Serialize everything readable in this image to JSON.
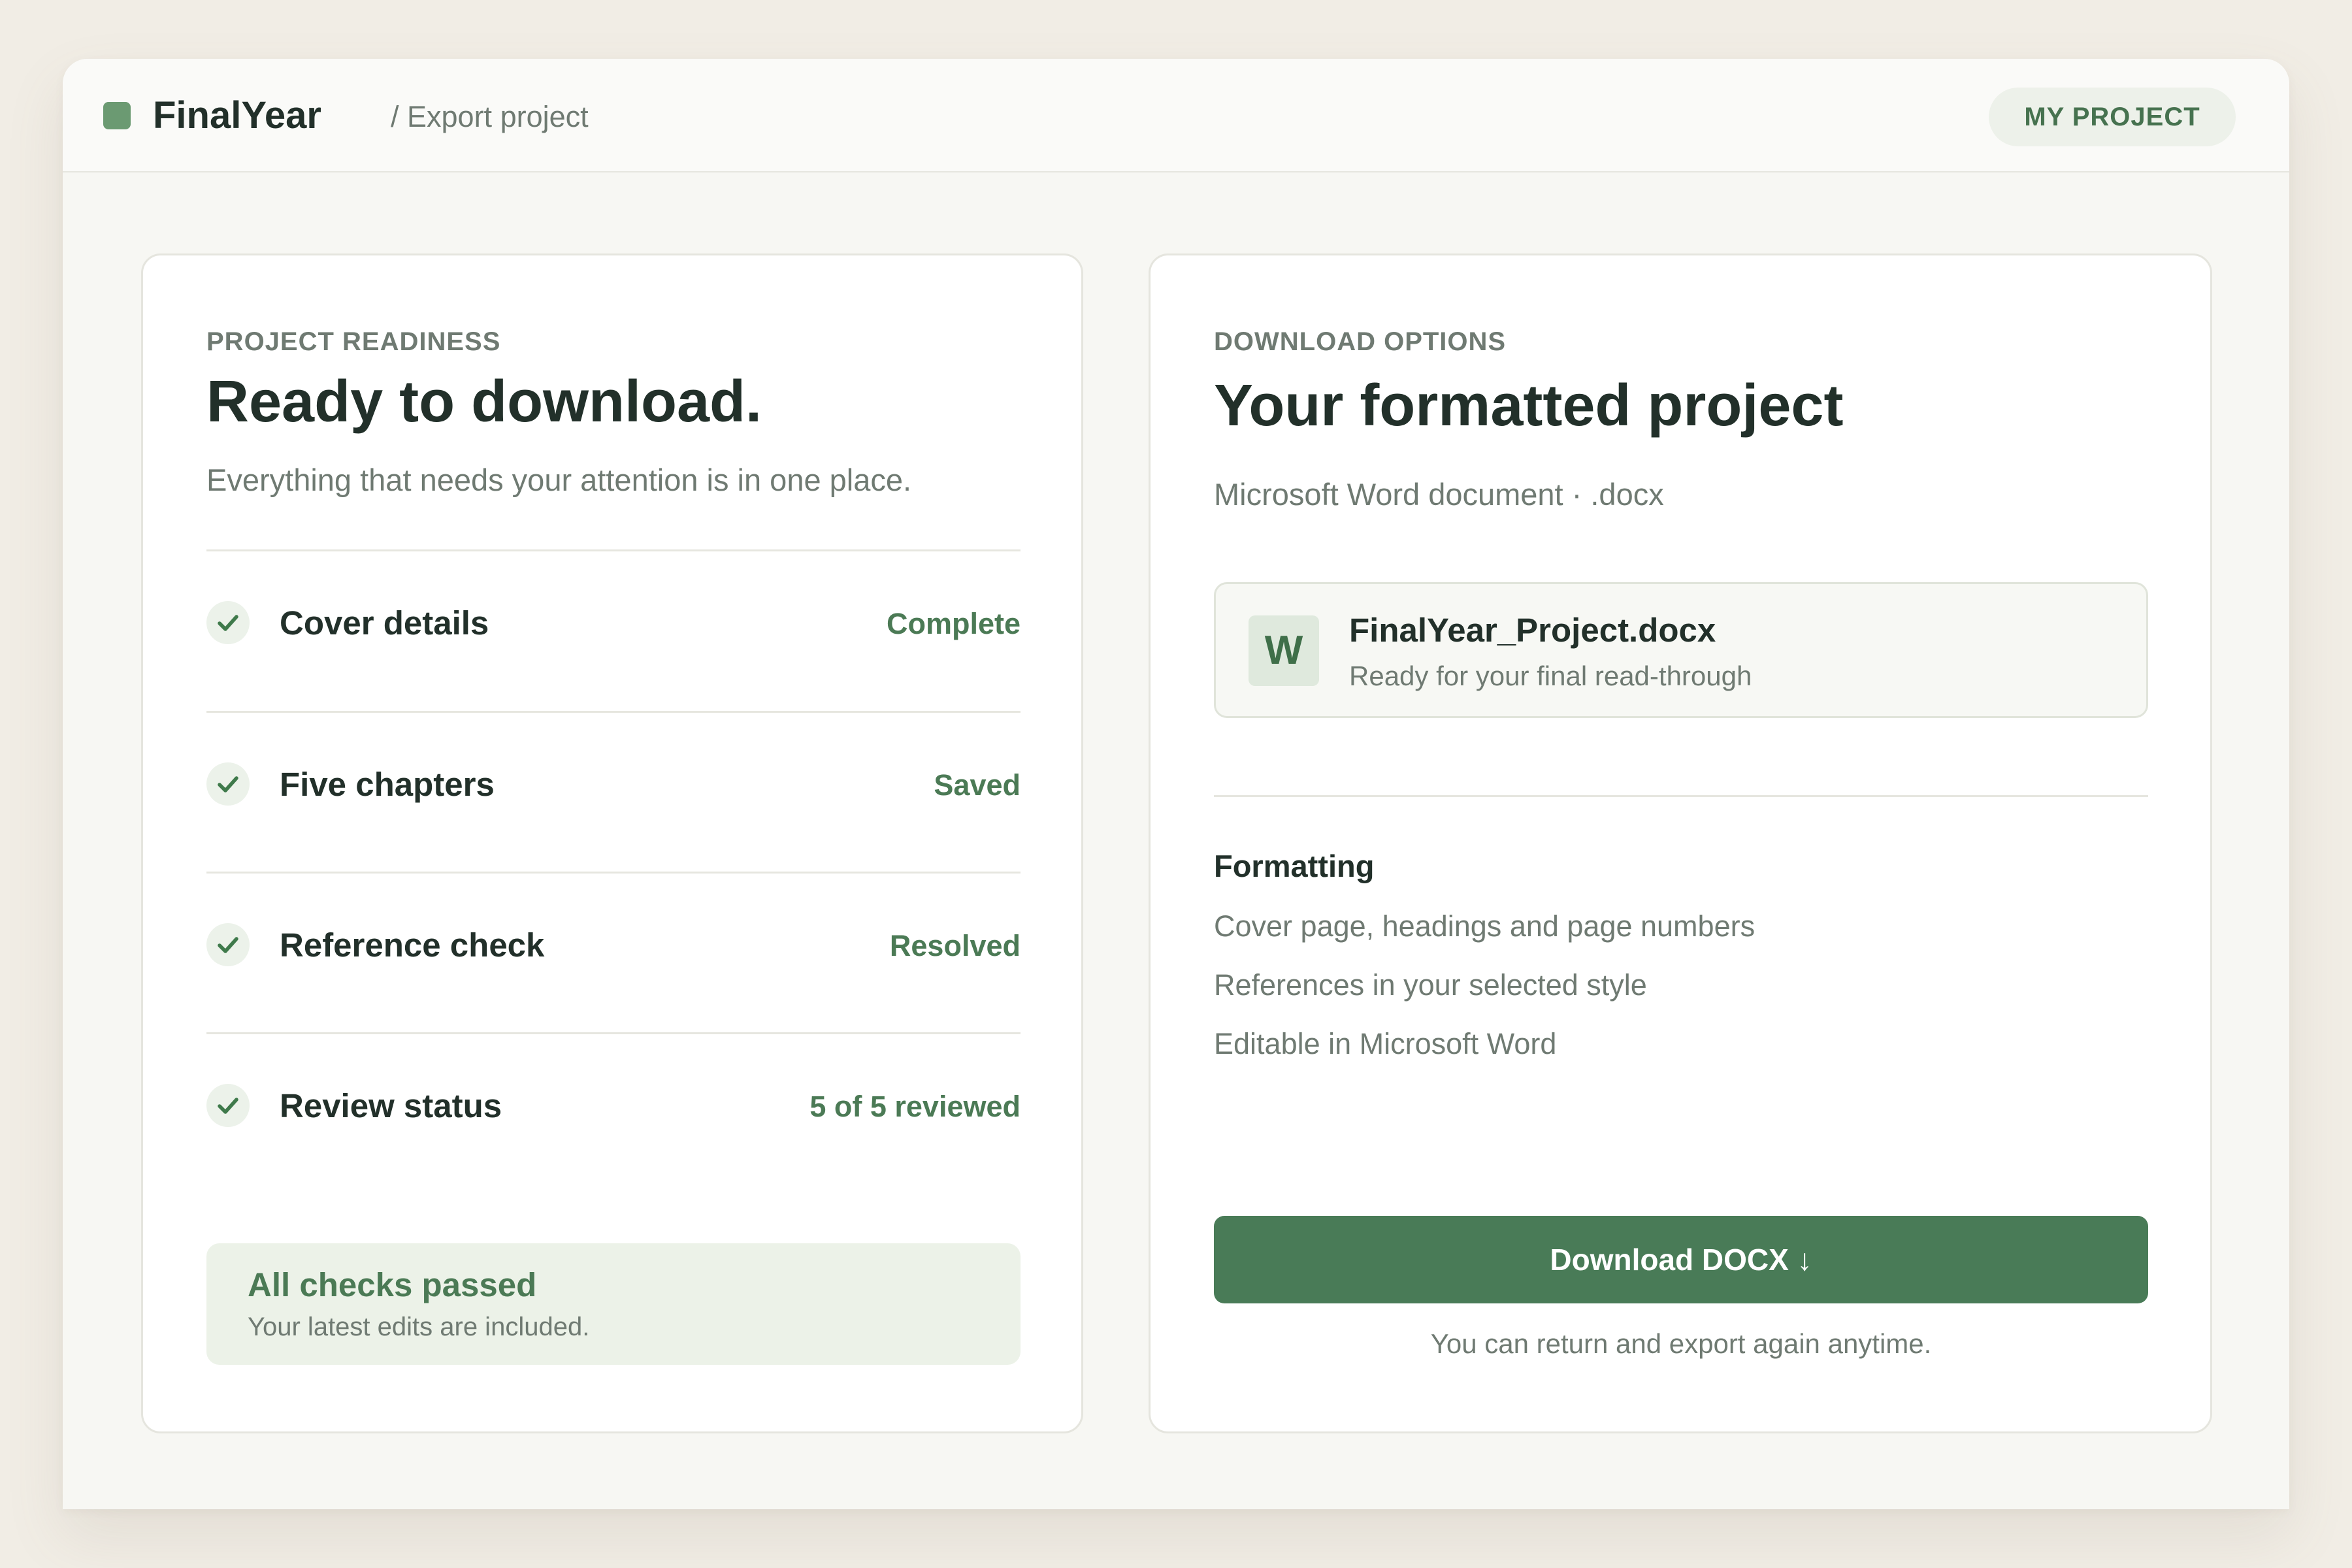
{
  "header": {
    "brand": "FinalYear",
    "breadcrumb": "/ Export project",
    "project_button": "MY PROJECT"
  },
  "readiness": {
    "eyebrow": "PROJECT READINESS",
    "title": "Ready to download.",
    "subtitle": "Everything that needs your attention is in one place.",
    "items": [
      {
        "label": "Cover details",
        "status": "Complete",
        "icon": "check-icon"
      },
      {
        "label": "Five chapters",
        "status": "Saved",
        "icon": "check-icon"
      },
      {
        "label": "Reference check",
        "status": "Resolved",
        "icon": "check-icon"
      },
      {
        "label": "Review status",
        "status": "5 of 5 reviewed",
        "icon": "check-icon"
      }
    ],
    "summary": {
      "title": "All checks passed",
      "subtitle": "Your latest edits are included."
    }
  },
  "download": {
    "eyebrow": "DOWNLOAD OPTIONS",
    "title": "Your formatted project",
    "subtitle": "Microsoft Word document · .docx",
    "file": {
      "icon_letter": "W",
      "name": "FinalYear_Project.docx",
      "status": "Ready for your final read-through"
    },
    "formatting": {
      "title": "Formatting",
      "lines": [
        "Cover page, headings and page numbers",
        "References in your selected style",
        "Editable in Microsoft Word"
      ]
    },
    "button_label": "Download DOCX ↓",
    "note": "You can return and export again anytime."
  },
  "colors": {
    "accent": "#497b57",
    "accent_soft": "#ecf2e8",
    "text_primary": "#22302a",
    "text_muted": "#6f7a72",
    "background": "#f1ede5"
  }
}
